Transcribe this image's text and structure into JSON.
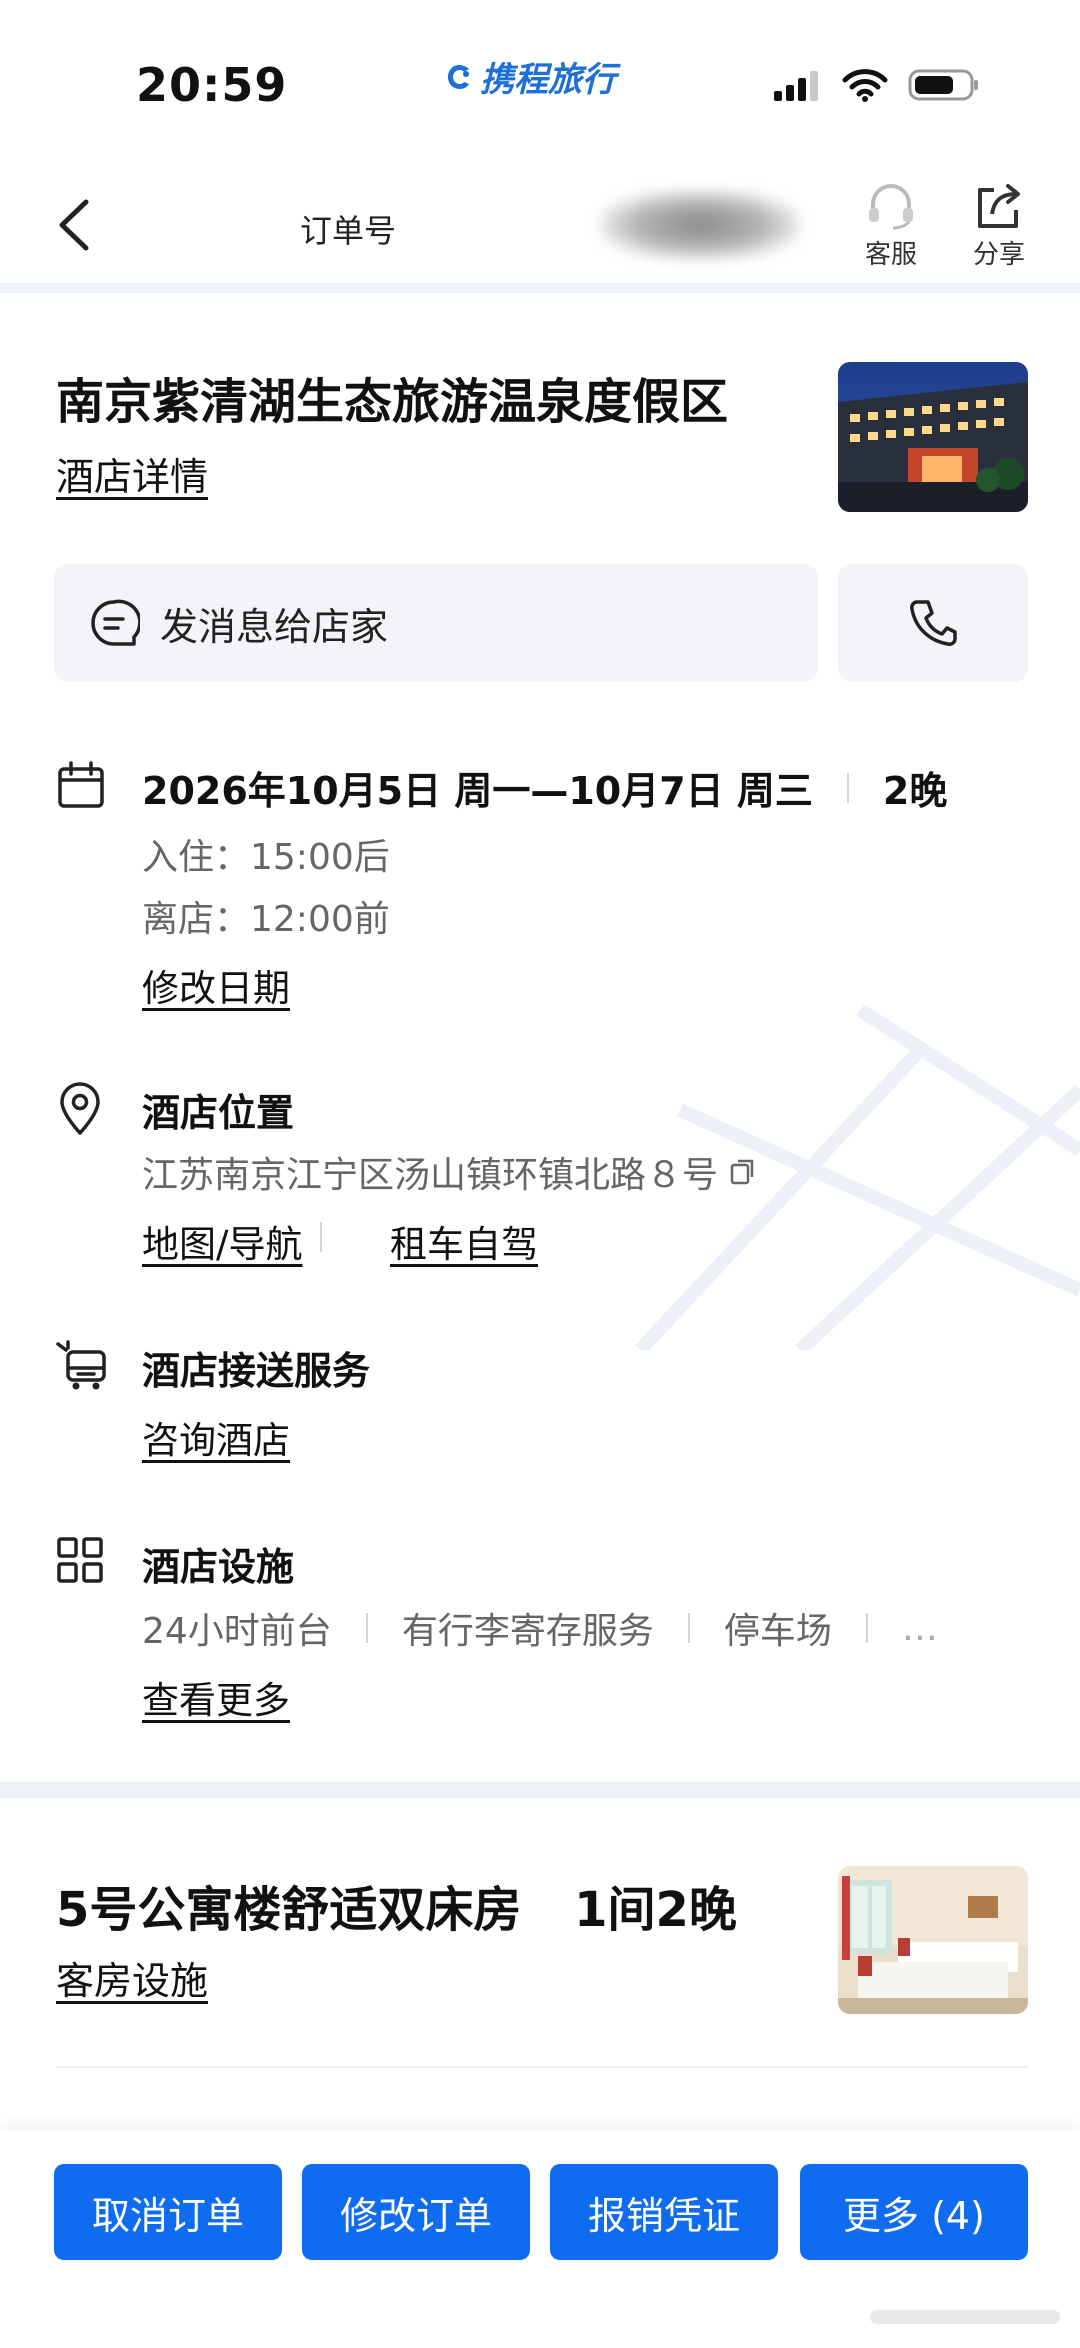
{
  "status_bar": {
    "time": "20:59",
    "brand": "携程旅行"
  },
  "nav": {
    "order_label": "订单号",
    "service_label": "客服",
    "share_label": "分享"
  },
  "hotel": {
    "name": "南京紫清湖生态旅游温泉度假区",
    "detail_link": "酒店详情"
  },
  "contact": {
    "message_label": "发消息给店家"
  },
  "stay": {
    "dates": "2026年10月5日 周一—10月7日 周三",
    "nights": "2晚",
    "check_in": "入住：15:00后",
    "check_out": "离店：12:00前",
    "modify_link": "修改日期"
  },
  "location": {
    "title": "酒店位置",
    "address": "江苏南京江宁区汤山镇环镇北路８号",
    "map_link": "地图/导航",
    "rental_link": "租车自驾"
  },
  "shuttle": {
    "title": "酒店接送服务",
    "consult_link": "咨询酒店"
  },
  "facilities": {
    "title": "酒店设施",
    "items": [
      "24小时前台",
      "有行李寄存服务",
      "停车场"
    ],
    "ellipsis": "…",
    "more_link": "查看更多"
  },
  "room": {
    "name": "5号公寓楼舒适双床房",
    "count": "1间2晚",
    "facilities_link": "客房设施"
  },
  "actions": {
    "cancel": "取消订单",
    "modify": "修改订单",
    "invoice": "报销凭证",
    "more": "更多 (4)"
  },
  "colors": {
    "primary": "#0f6bf0",
    "brand": "#1f6fd8",
    "divider": "#eef1f6",
    "button_bg": "#f3f4f7"
  }
}
